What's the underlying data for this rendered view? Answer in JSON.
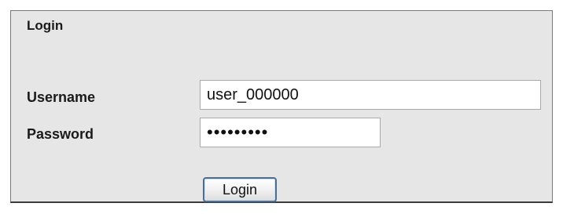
{
  "login_panel": {
    "title": "Login",
    "username": {
      "label": "Username",
      "value": "user_000000"
    },
    "password": {
      "label": "Password",
      "value": "•••••••••"
    },
    "submit_label": "Login"
  }
}
